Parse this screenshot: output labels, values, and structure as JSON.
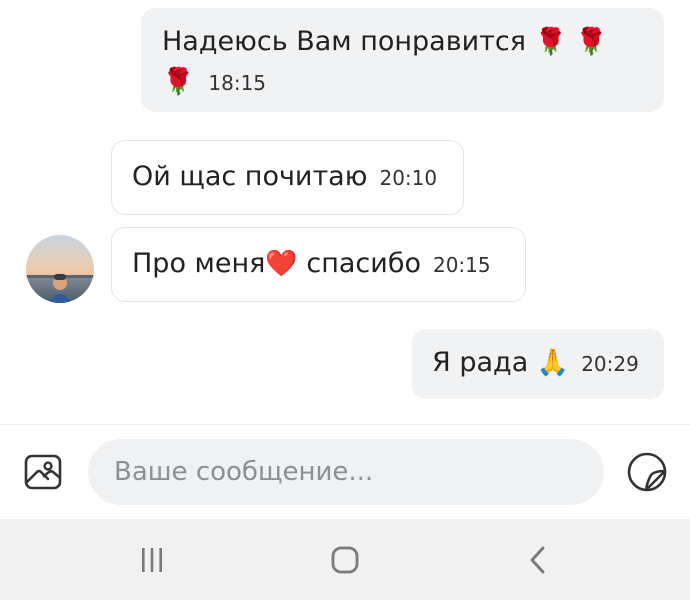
{
  "messages": [
    {
      "direction": "out",
      "text": "Надеюсь Вам понравится",
      "emoji_line1": "🌹 🌹",
      "emoji_line2": "🌹",
      "time": "18:15"
    },
    {
      "direction": "in",
      "text": "Ой щас почитаю",
      "time": "20:10"
    },
    {
      "direction": "in",
      "text_before": "Про меня",
      "emoji": "❤️",
      "text_after": " спасибо",
      "time": "20:15"
    },
    {
      "direction": "out",
      "text": "Я рада ",
      "emoji": "🙏",
      "time": "20:29"
    }
  ],
  "sender": {
    "avatar_icon": "user-avatar-sunset"
  },
  "composer": {
    "placeholder": "Ваше сообщение...",
    "value": "",
    "attach_icon": "image-icon",
    "sticker_icon": "sticker-icon"
  },
  "navbar": {
    "recents_icon": "recents-icon",
    "home_icon": "home-icon",
    "back_icon": "back-icon"
  },
  "colors": {
    "outgoing_bubble": "#f1f2f4",
    "incoming_border": "#e2e4e8",
    "input_bg": "#f0f1f3",
    "placeholder": "#8a9098",
    "navbar_bg": "#f1f1f1",
    "heart": "#e0242e"
  }
}
